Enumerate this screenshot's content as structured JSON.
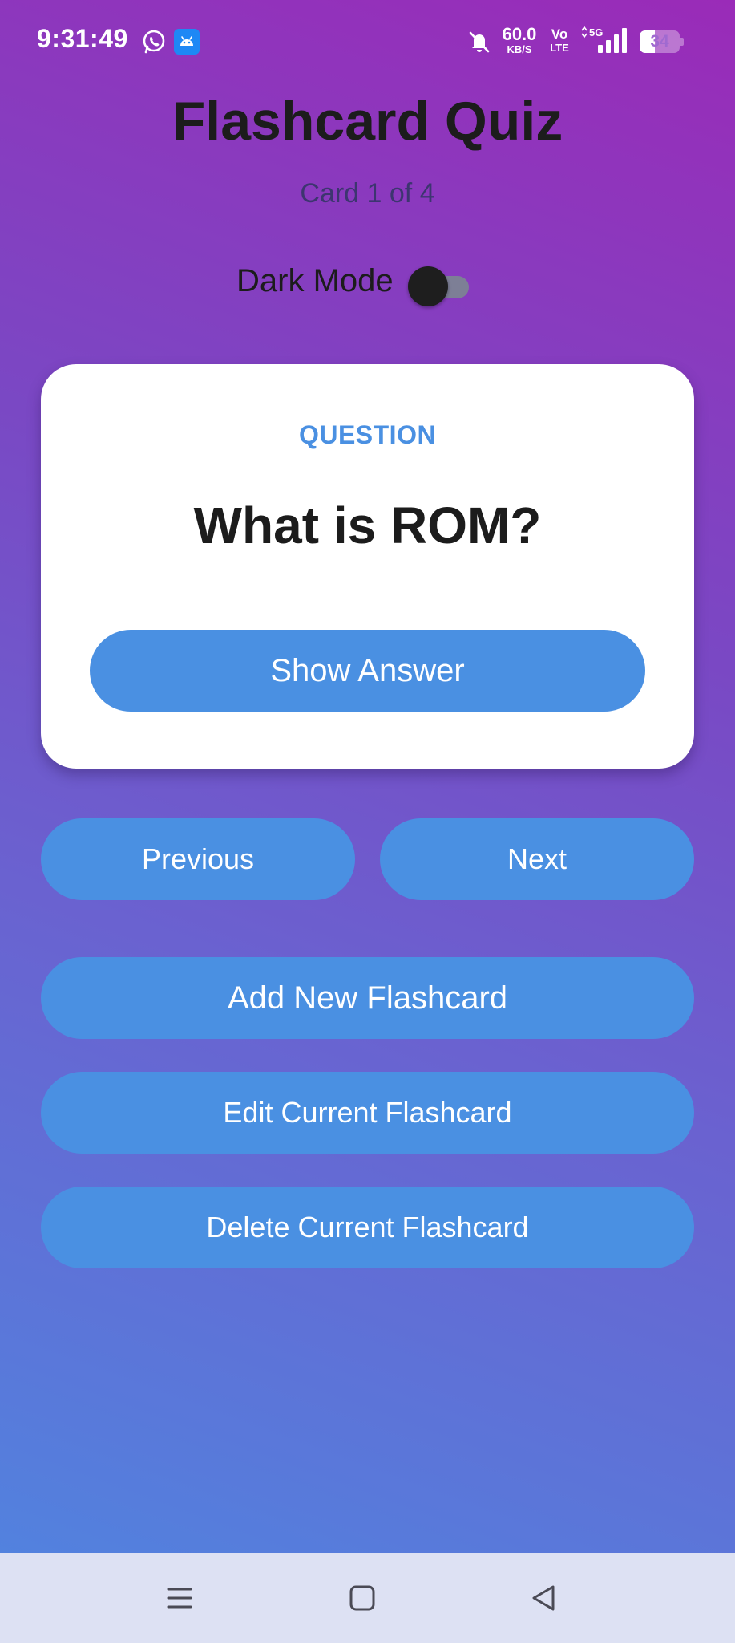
{
  "status_bar": {
    "time": "9:31:49",
    "net_speed_value": "60.0",
    "net_speed_unit": "KB/S",
    "volte_top": "Vo",
    "volte_bottom": "LTE",
    "network_type": "5G",
    "battery_level": "34",
    "icons": [
      "whatsapp-icon",
      "android-app-icon",
      "mute-icon",
      "signal-icon",
      "battery-icon"
    ]
  },
  "header": {
    "title": "Flashcard Quiz",
    "progress": "Card 1 of 4",
    "dark_mode_label": "Dark Mode",
    "dark_mode_on": false
  },
  "card": {
    "label": "QUESTION",
    "question": "What is ROM?",
    "show_answer_label": "Show Answer"
  },
  "navigation": {
    "previous_label": "Previous",
    "next_label": "Next"
  },
  "actions": {
    "add_label": "Add New Flashcard",
    "edit_label": "Edit Current Flashcard",
    "delete_label": "Delete Current Flashcard"
  },
  "colors": {
    "accent": "#4a90e2",
    "gradient_top": "#9a2bb8",
    "gradient_bottom": "#4f86e0",
    "card_bg": "#ffffff",
    "nav_bar_bg": "#dde1f3"
  },
  "system_nav": {
    "icons": [
      "menu-icon",
      "home-icon",
      "back-icon"
    ]
  }
}
